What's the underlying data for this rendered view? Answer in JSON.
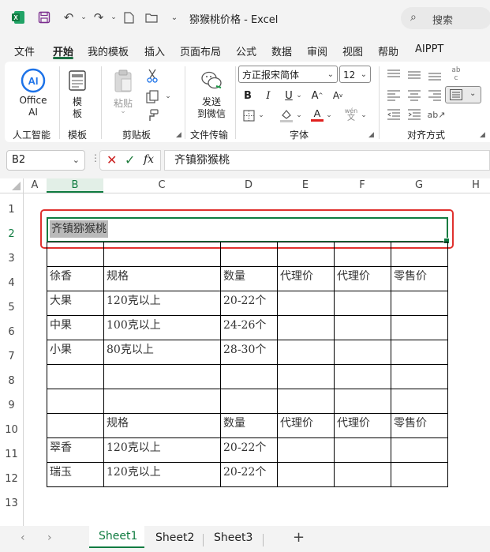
{
  "titlebar": {
    "title": "猕猴桃价格  -  Excel",
    "search_label": "搜索"
  },
  "menu": [
    "文件",
    "开始",
    "我的模板",
    "插入",
    "页面布局",
    "公式",
    "数据",
    "审阅",
    "视图",
    "帮助",
    "AIPPT"
  ],
  "ribbon": {
    "office_ai_line1": "Office",
    "office_ai_line2": "AI",
    "group_ai": "人工智能",
    "template_line1": "模",
    "template_line2": "板",
    "group_template": "模板",
    "paste_label": "粘贴",
    "group_clipboard": "剪贴板",
    "send_line1": "发送",
    "send_line2": "到微信",
    "group_transfer": "文件传输",
    "font_name": "方正报宋简体",
    "font_size": "12",
    "group_font": "字体",
    "group_align": "对齐方式"
  },
  "formula_bar": {
    "name_box": "B2",
    "formula": "齐镇猕猴桃"
  },
  "columns": [
    "A",
    "B",
    "C",
    "D",
    "E",
    "F",
    "G",
    "H"
  ],
  "rows": [
    "1",
    "2",
    "3",
    "4",
    "5",
    "6",
    "7",
    "8",
    "9",
    "10",
    "11",
    "12",
    "13"
  ],
  "cells": {
    "b2": "齐镇猕猴桃",
    "b4": "徐香",
    "c4": "规格",
    "d4": "数量",
    "e4": "代理价",
    "f4": "代理价",
    "g4": "零售价",
    "b5": "大果",
    "c5": "120克以上",
    "d5": "20-22个",
    "b6": "中果",
    "c6": "100克以上",
    "d6": "24-26个",
    "b7": "小果",
    "c7": "80克以上",
    "d7": "28-30个",
    "c10": "规格",
    "d10": "数量",
    "e10": "代理价",
    "f10": "代理价",
    "g10": "零售价",
    "b11": "翠香",
    "c11": "120克以上",
    "d11": "20-22个",
    "b12": "瑞玉",
    "c12": "120克以上",
    "d12": "20-22个"
  },
  "sheets": [
    "Sheet1",
    "Sheet2",
    "Sheet3"
  ],
  "colors": {
    "accent": "#107c41",
    "highlight_box": "#e0312e",
    "selection_fill": "#b9b9b9"
  }
}
